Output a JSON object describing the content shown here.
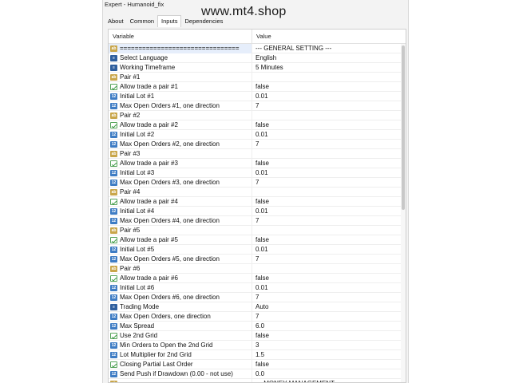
{
  "window": {
    "title": "Expert - Humanoid_fix"
  },
  "watermark": "www.mt4.shop",
  "tabs": [
    {
      "label": "About",
      "active": false
    },
    {
      "label": "Common",
      "active": false
    },
    {
      "label": "Inputs",
      "active": true
    },
    {
      "label": "Dependencies",
      "active": false
    }
  ],
  "table": {
    "columns": [
      "Variable",
      "Value"
    ],
    "rows": [
      {
        "icon": "ab",
        "variable": "================================",
        "value": "--- GENERAL SETTING ---"
      },
      {
        "icon": "enum",
        "variable": "Select Language",
        "value": "English"
      },
      {
        "icon": "enum",
        "variable": "Working Timeframe",
        "value": "5 Minutes"
      },
      {
        "icon": "ab",
        "variable": "Pair #1",
        "value": ""
      },
      {
        "icon": "bool",
        "variable": "Allow trade a pair #1",
        "value": "false"
      },
      {
        "icon": "num",
        "variable": "Initial Lot #1",
        "value": "0.01"
      },
      {
        "icon": "num",
        "variable": "Max Open Orders #1, one direction",
        "value": "7"
      },
      {
        "icon": "ab",
        "variable": "Pair #2",
        "value": ""
      },
      {
        "icon": "bool",
        "variable": "Allow trade a pair #2",
        "value": "false"
      },
      {
        "icon": "num",
        "variable": "Initial Lot #2",
        "value": "0.01"
      },
      {
        "icon": "num",
        "variable": "Max Open Orders #2, one direction",
        "value": "7"
      },
      {
        "icon": "ab",
        "variable": "Pair #3",
        "value": ""
      },
      {
        "icon": "bool",
        "variable": "Allow trade a pair #3",
        "value": "false"
      },
      {
        "icon": "num",
        "variable": "Initial Lot #3",
        "value": "0.01"
      },
      {
        "icon": "num",
        "variable": "Max Open Orders #3, one direction",
        "value": "7"
      },
      {
        "icon": "ab",
        "variable": "Pair #4",
        "value": ""
      },
      {
        "icon": "bool",
        "variable": "Allow trade a pair #4",
        "value": "false"
      },
      {
        "icon": "num",
        "variable": "Initial Lot #4",
        "value": "0.01"
      },
      {
        "icon": "num",
        "variable": "Max Open Orders #4, one direction",
        "value": "7"
      },
      {
        "icon": "ab",
        "variable": "Pair #5",
        "value": ""
      },
      {
        "icon": "bool",
        "variable": "Allow trade a pair #5",
        "value": "false"
      },
      {
        "icon": "num",
        "variable": "Initial Lot #5",
        "value": "0.01"
      },
      {
        "icon": "num",
        "variable": "Max Open Orders #5, one direction",
        "value": "7"
      },
      {
        "icon": "ab",
        "variable": "Pair #6",
        "value": ""
      },
      {
        "icon": "bool",
        "variable": "Allow trade a pair #6",
        "value": "false"
      },
      {
        "icon": "num",
        "variable": "Initial Lot #6",
        "value": "0.01"
      },
      {
        "icon": "num",
        "variable": "Max Open Orders #6, one direction",
        "value": "7"
      },
      {
        "icon": "enum",
        "variable": "Trading Mode",
        "value": "Auto"
      },
      {
        "icon": "num",
        "variable": "Max Open Orders, one direction",
        "value": "7"
      },
      {
        "icon": "num",
        "variable": "Max Spread",
        "value": "6.0"
      },
      {
        "icon": "bool",
        "variable": "Use 2nd Grid",
        "value": "false"
      },
      {
        "icon": "num",
        "variable": "Min Orders to Open the 2nd Grid",
        "value": "3"
      },
      {
        "icon": "num",
        "variable": "Lot Multiplier for 2nd Grid",
        "value": "1.5"
      },
      {
        "icon": "bool",
        "variable": "Closing Partial Last Order",
        "value": "false"
      },
      {
        "icon": "num",
        "variable": "Send Push if Drawdown (0.00 - not use)",
        "value": "0.0"
      },
      {
        "icon": "ab",
        "variable": "================================",
        "value": "--- MONEY MANAGEMENT ---"
      }
    ]
  },
  "colors": {
    "selection": "#e6eefb",
    "icon_string": "#c9a64a",
    "icon_number": "#3e7cc4",
    "icon_bool": "#58a55c",
    "icon_enum": "#2f5f9e"
  },
  "icons": {
    "ab": "string-icon",
    "num": "number-icon",
    "bool": "bool-icon",
    "enum": "enum-icon"
  }
}
